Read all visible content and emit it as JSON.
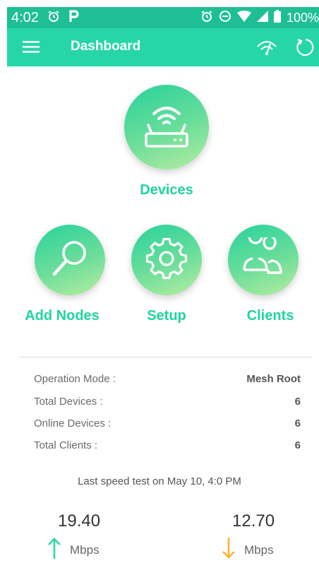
{
  "status_bar": {
    "time": "4:02",
    "battery": "100%",
    "icons": [
      "alarm-icon",
      "parking-icon",
      "alarm-icon",
      "do-not-disturb-icon",
      "wifi-icon",
      "signal-icon",
      "battery-icon"
    ]
  },
  "app_bar": {
    "title": "Dashboard",
    "icons": [
      "menu-icon",
      "speedometer-icon",
      "refresh-icon"
    ]
  },
  "dashboard": {
    "devices_label": "Devices",
    "add_nodes_label": "Add Nodes",
    "setup_label": "Setup",
    "clients_label": "Clients"
  },
  "info": {
    "rows": [
      {
        "label": "Operation Mode :",
        "value": "Mesh Root"
      },
      {
        "label": "Total Devices :",
        "value": "6"
      },
      {
        "label": "Online Devices :",
        "value": "6"
      },
      {
        "label": "Total Clients :",
        "value": "6"
      }
    ]
  },
  "speed_test": {
    "text": "Last speed test on May 10, 4:0 PM",
    "upload": {
      "value": "19.40",
      "unit": "Mbps"
    },
    "download": {
      "value": "12.70",
      "unit": "Mbps"
    }
  },
  "colors": {
    "status_bar": "#1fbf95",
    "app_bar": "#26d6a6",
    "accent_text": "#1ed4a0",
    "upload_arrow": "#2fd6a8",
    "download_arrow": "#f6b52d"
  }
}
